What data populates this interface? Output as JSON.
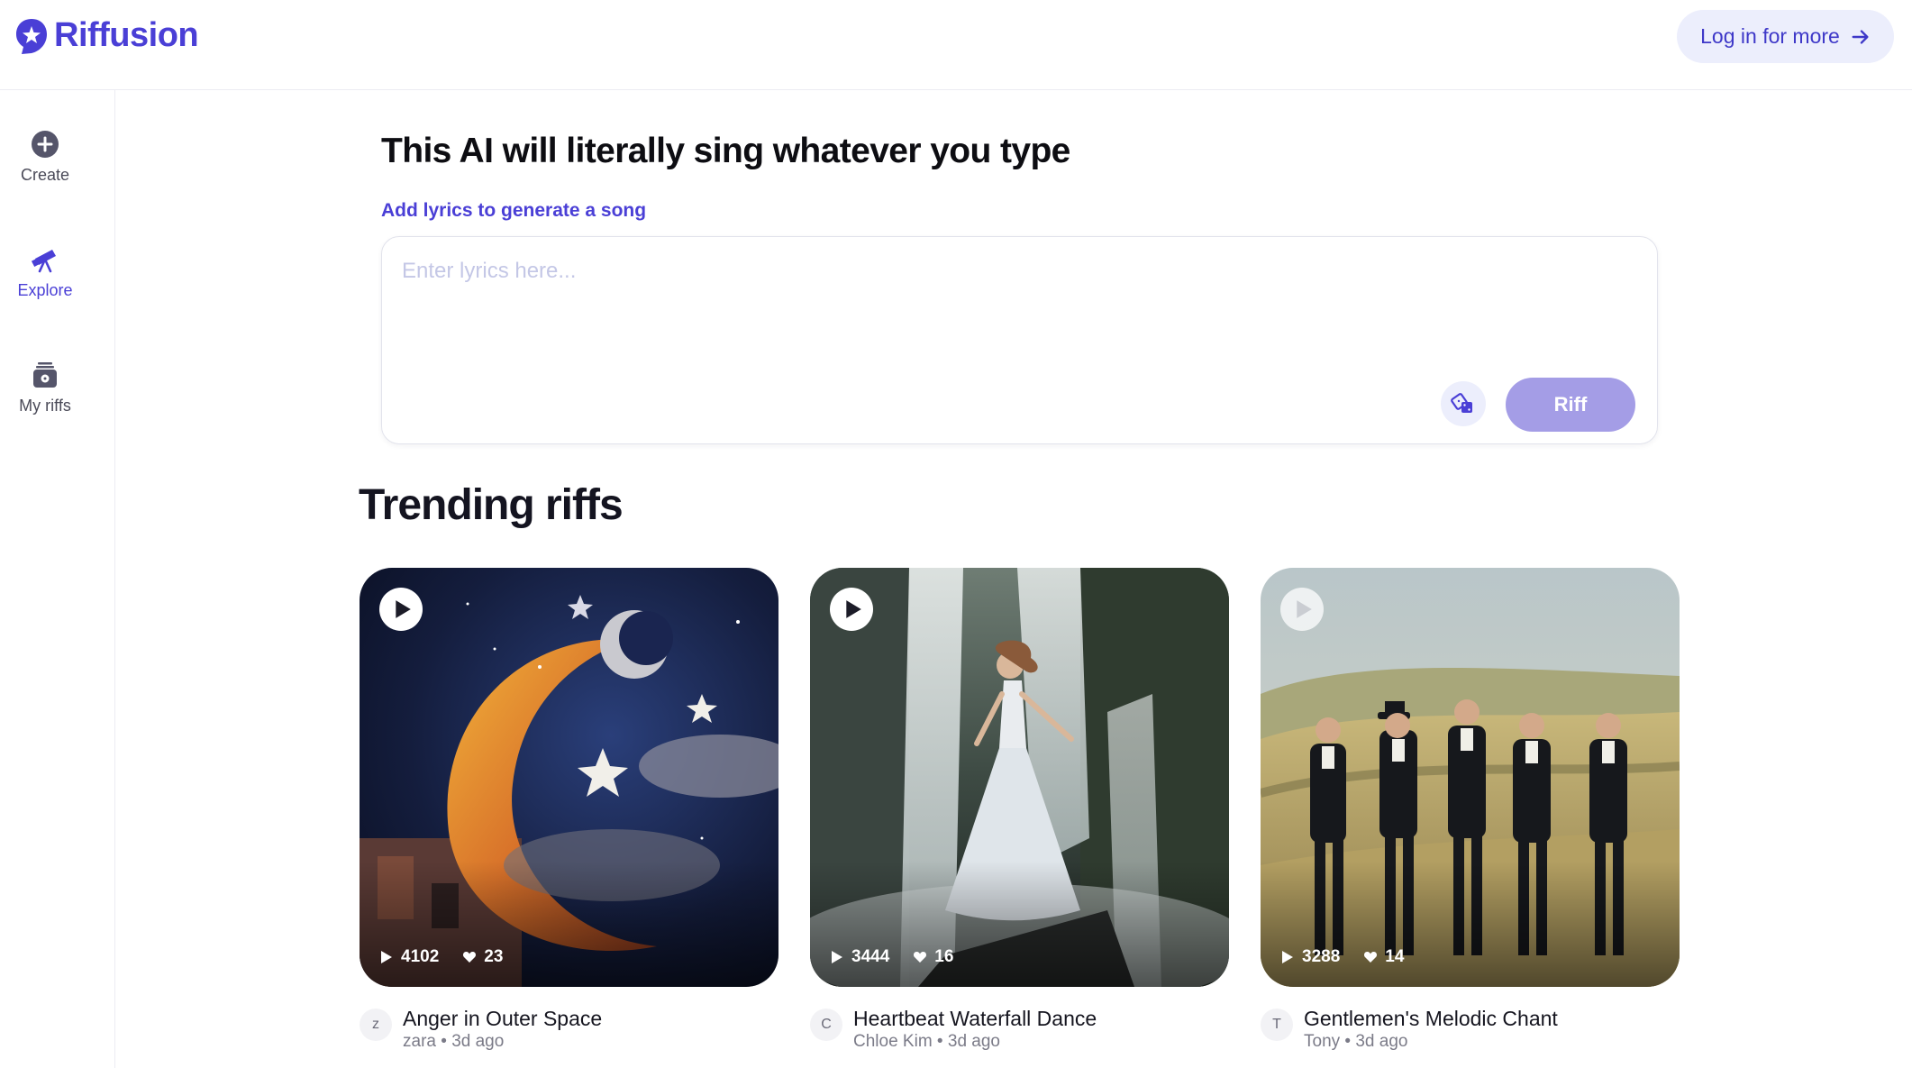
{
  "header": {
    "logo_text": "Riffusion",
    "login_label": "Log in for more"
  },
  "sidebar": {
    "items": [
      {
        "label": "Create",
        "icon": "plus-circle-icon"
      },
      {
        "label": "Explore",
        "icon": "telescope-icon",
        "active": true
      },
      {
        "label": "My riffs",
        "icon": "library-icon"
      }
    ]
  },
  "main": {
    "headline": "This AI will literally sing whatever you type",
    "sublabel": "Add lyrics to generate a song",
    "lyrics_placeholder": "Enter lyrics here...",
    "lyrics_value": "",
    "riff_label": "Riff",
    "section_title": "Trending riffs"
  },
  "cards": [
    {
      "title": "Anger in Outer Space",
      "avatar": "z",
      "author": "zara",
      "age": "3d ago",
      "plays": "4102",
      "likes": "23"
    },
    {
      "title": "Heartbeat Waterfall Dance",
      "avatar": "C",
      "author": "Chloe Kim",
      "age": "3d ago",
      "plays": "3444",
      "likes": "16"
    },
    {
      "title": "Gentlemen's Melodic Chant",
      "avatar": "T",
      "author": "Tony",
      "age": "3d ago",
      "plays": "3288",
      "likes": "14"
    }
  ],
  "colors": {
    "brand": "#4a3fd6",
    "riff_button": "#a49de6",
    "login_bg": "#eceefc"
  }
}
